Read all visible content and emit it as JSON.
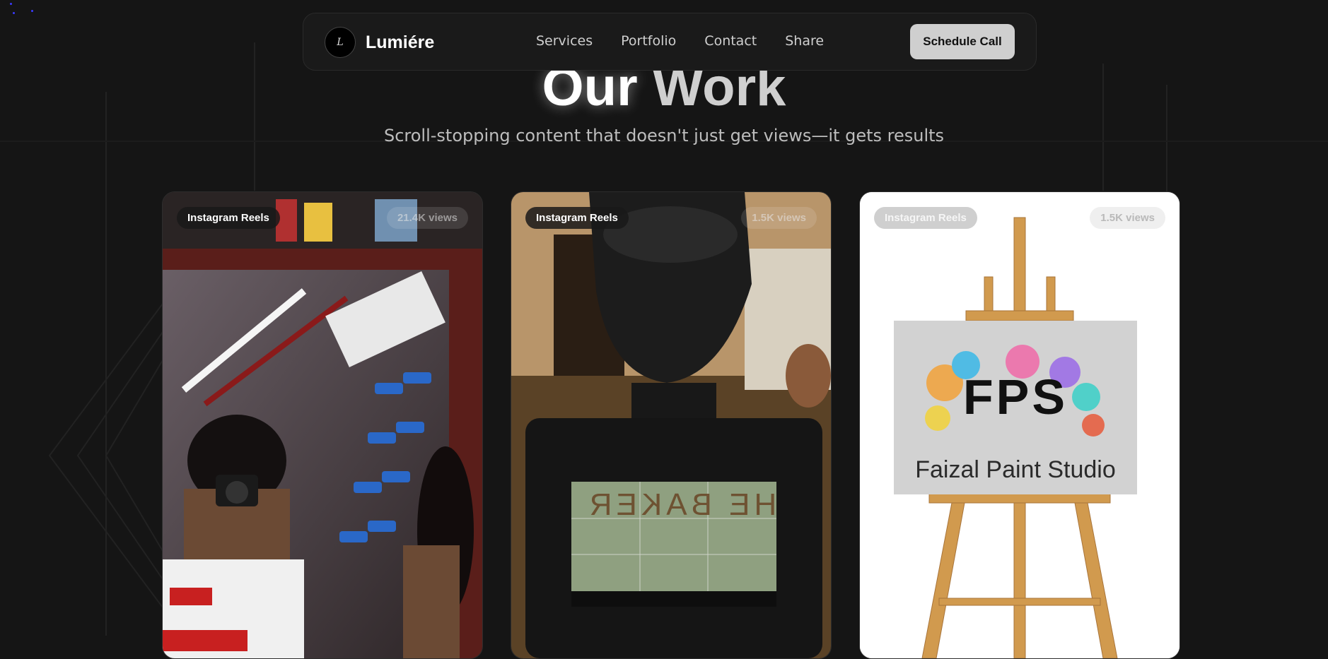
{
  "nav": {
    "brand": "Lumiére",
    "logo_mark": "L",
    "links": [
      "Services",
      "Portfolio",
      "Contact",
      "Share"
    ],
    "cta": "Schedule Call"
  },
  "hero": {
    "title_word1": "Our",
    "title_word2": "Work",
    "subtitle": "Scroll-stopping content that doesn't just get views—it gets results"
  },
  "cards": [
    {
      "platform": "Instagram Reels",
      "views": "21.4K views"
    },
    {
      "platform": "Instagram Reels",
      "views": "1.5K views",
      "screen_text": "HE BAKER"
    },
    {
      "platform": "Instagram Reels",
      "views": "1.5K views",
      "logo_text": "FPS",
      "studio": "Faizal Paint Studio"
    }
  ],
  "colors": {
    "background": "#151515",
    "nav_bg": "#1a1a1a",
    "cta_bg": "#cfcfcf",
    "accent_dot": "#3b3bff"
  }
}
